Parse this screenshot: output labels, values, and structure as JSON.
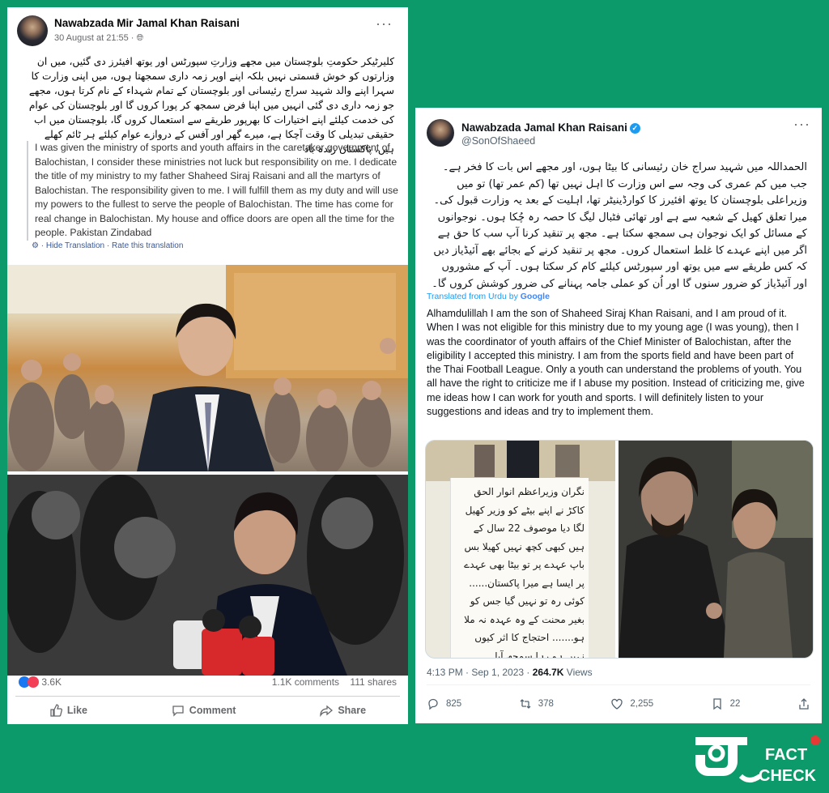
{
  "facebook": {
    "author": "Nawabzada Mir Jamal Khan Raisani",
    "date": "30 August at 21:55 · ",
    "more": "···",
    "urdu_text": "کلیرٹیکر حکومتِ بلوچستان میں مجھے وزارتِ سپورٹس اور یوتھ افیئرز دی گئیں، میں ان وزارتوں کو خوش قسمتی نہیں بلکہ اپنے اوپر زمہ داری سمجھتا ہوں، میں اپنی وزارت کا سہرا اپنے والد شہید سراج رئیسانی اور بلوچستان کے تمام شہداء کے نام کرتا ہوں، مجھے جو زمہ داری دی گئی انہیں میں اپنا فرض سمجھ کر پورا کروں گا اور بلوچستان کی عوام کی خدمت کیلئے اپنے اختیارات کا بھرپور طریقے سے استعمال کروں گا، بلوچستان میں اب حقیقی تبدیلی کا وقت آچکا ہے، میرے گھر اور آفس کے دروازے عوام کیلئے ہر ٹائم کھلے ہیں، پاکستان زندہ باد",
    "translation": "I was given the ministry of sports and youth affairs in the caretaker government of Balochistan, I consider these ministries not luck but responsibility on me. I dedicate the title of my ministry to my father Shaheed Siraj Raisani and all the martyrs of Balochistan. The responsibility given to me. I will fulfill them as my duty and will use my powers to the fullest to serve the people of Balochistan. The time has come for real change in Balochistan. My house and office doors are open all the time for the people. Pakistan Zindabad",
    "hide_translation": "· Hide Translation",
    "rate_translation": "· Rate this translation",
    "reactions": "3.6K",
    "comments": "1.1K comments",
    "shares": "111 shares",
    "like": "Like",
    "comment": "Comment",
    "share": "Share"
  },
  "twitter": {
    "name": "Nawabzada Jamal Khan Raisani",
    "handle": "@SonOfShaeed",
    "more": "···",
    "urdu_text": "الحمداللہ میں شہید سراج خان رئیسانی کا بیٹا ہوں، اور مجھے اس بات کا فخر ہے۔ جب میں کم عمری کی وجہ سے اس وزارت کا اہل نہیں تھا (کم عمر تھا) تو میں وزیراعلی بلوچستان کا یوتھ افئیرز کا کوارڈینیٹر تھا، اہلیت کے بعد یہ وزارت قبول کی۔ میرا تعلق کھیل کے شعبہ سے ہے اور تھائی فٹبال لیگ کا حصہ رہ چُکا ہوں۔ نوجوانوں کے مسائل کو ایک نوجوان ہی سمجھ سکتا ہے۔ مجھ پر تنقید کرنا آپ سب کا حق ہے اگر میں اپنے عہدے کا غلط استعمال کروں۔ مجھ پر تنقید کرنے کے بجائے بھے آئیڈیاز دیں کہ کس طریقے سے میں یوتھ اور سپورٹس کیلئے کام کر سکتا ہوں۔ آپ کے مشوروں اور آئیڈیاز کو ضرور سنوں گا اور اُن کو عملی جامہ پہنانے کی ضرور کوشش کروں گا۔",
    "translated_from": "Translated from Urdu by ",
    "google": "Google",
    "english_text": "Alhamdulillah I am the son of Shaheed Siraj Khan Raisani, and I am proud of it. When I was not eligible for this ministry due to my young age (I was young), then I was the coordinator of youth affairs of the Chief Minister of Balochistan, after the eligibility I accepted this ministry. I am from the sports field and have been part of the Thai Football League. Only a youth can understand the problems of youth. You all have the right to criticize me if I abuse my position. Instead of criticizing me, give me ideas how I can work for youth and sports. I will definitely listen to your suggestions and ideas and try to implement them.",
    "handwritten_note": "نگران وزیراعظم انوار الحق کاکڑ نے اپنے بیٹے کو وزیر کھیل لگا دیا موصوف 22 سال کے ہیں کبھی کچھ نہیں کھیلا بس باپ عہدے پر تو بیٹا بھی عہدے پر ایسا ہے میرا پاکستان...... کوئی رہ تو نہیں گیا جس کو بغیر محنت کے وہ عہدہ نہ ملا ہو....... احتجاج کا اثر کیوں نہیں ہو رہا سمجھ آیا ......",
    "time": "4:13 PM · Sep 1, 2023 · ",
    "views": "264.7K",
    "views_label": " Views",
    "replies": "825",
    "retweets": "378",
    "likes": "2,255",
    "bookmarks": "22"
  },
  "logo": {
    "word1": "FACT",
    "word2": "CHECK"
  }
}
